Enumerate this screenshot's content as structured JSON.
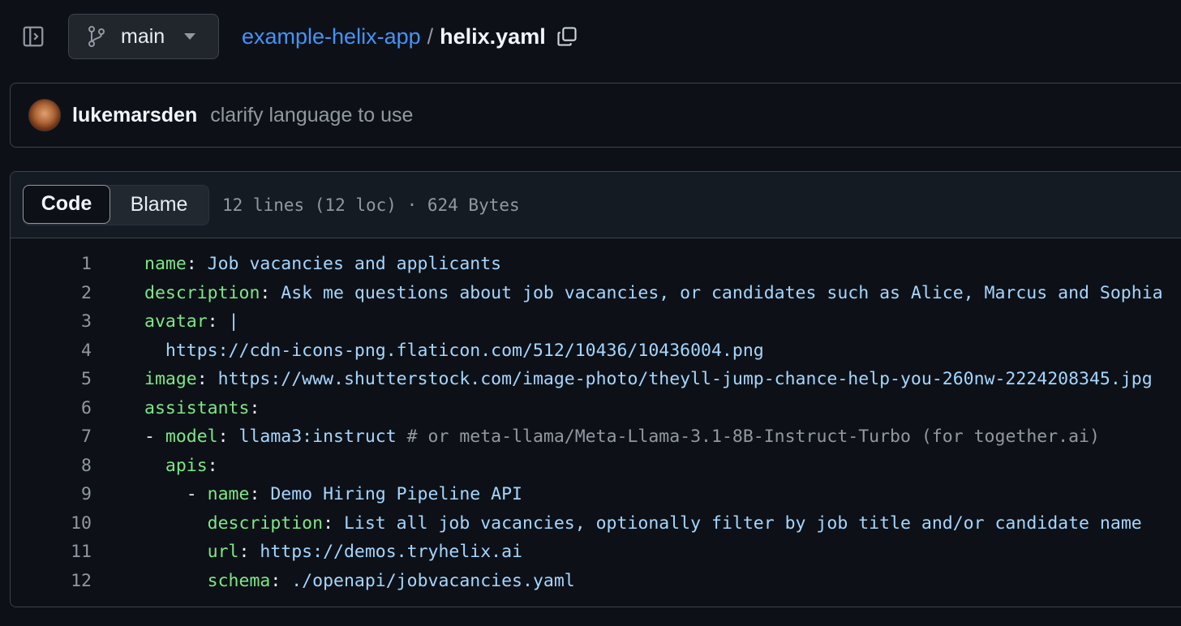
{
  "header": {
    "branch": "main",
    "repo": "example-helix-app",
    "separator": "/",
    "file": "helix.yaml"
  },
  "commit": {
    "author": "lukemarsden",
    "message": "clarify language to use"
  },
  "file_view": {
    "tabs": {
      "code": "Code",
      "blame": "Blame"
    },
    "meta": "12 lines (12 loc) · 624 Bytes"
  },
  "code_lines": [
    {
      "n": "1",
      "indent": "",
      "dash": "",
      "key": "name",
      "colon": ": ",
      "value": "Job vacancies and applicants",
      "comment": ""
    },
    {
      "n": "2",
      "indent": "",
      "dash": "",
      "key": "description",
      "colon": ": ",
      "value": "Ask me questions about job vacancies, or candidates such as Alice, Marcus and Sophia",
      "comment": ""
    },
    {
      "n": "3",
      "indent": "",
      "dash": "",
      "key": "avatar",
      "colon": ": ",
      "value": "|",
      "comment": ""
    },
    {
      "n": "4",
      "indent": "  ",
      "dash": "",
      "key": "",
      "colon": "",
      "value": "https://cdn-icons-png.flaticon.com/512/10436/10436004.png",
      "comment": ""
    },
    {
      "n": "5",
      "indent": "",
      "dash": "",
      "key": "image",
      "colon": ": ",
      "value": "https://www.shutterstock.com/image-photo/theyll-jump-chance-help-you-260nw-2224208345.jpg",
      "comment": ""
    },
    {
      "n": "6",
      "indent": "",
      "dash": "",
      "key": "assistants",
      "colon": ":",
      "value": "",
      "comment": ""
    },
    {
      "n": "7",
      "indent": "",
      "dash": "- ",
      "key": "model",
      "colon": ": ",
      "value": "llama3:instruct ",
      "comment": "# or meta-llama/Meta-Llama-3.1-8B-Instruct-Turbo (for together.ai)"
    },
    {
      "n": "8",
      "indent": "  ",
      "dash": "",
      "key": "apis",
      "colon": ":",
      "value": "",
      "comment": ""
    },
    {
      "n": "9",
      "indent": "    ",
      "dash": "- ",
      "key": "name",
      "colon": ": ",
      "value": "Demo Hiring Pipeline API",
      "comment": ""
    },
    {
      "n": "10",
      "indent": "      ",
      "dash": "",
      "key": "description",
      "colon": ": ",
      "value": "List all job vacancies, optionally filter by job title and/or candidate name",
      "comment": ""
    },
    {
      "n": "11",
      "indent": "      ",
      "dash": "",
      "key": "url",
      "colon": ": ",
      "value": "https://demos.tryhelix.ai",
      "comment": ""
    },
    {
      "n": "12",
      "indent": "      ",
      "dash": "",
      "key": "schema",
      "colon": ": ",
      "value": "./openapi/jobvacancies.yaml",
      "comment": ""
    }
  ],
  "icons": {
    "sidebar_toggle": "sidebar-expand-icon",
    "branch": "git-branch-icon",
    "caret": "triangle-down-icon",
    "copy": "copy-icon"
  },
  "colors": {
    "background": "#0d1117",
    "link": "#4493f8",
    "yaml_key": "#7ee787",
    "yaml_value": "#a5d6ff",
    "comment": "#9198a1"
  }
}
